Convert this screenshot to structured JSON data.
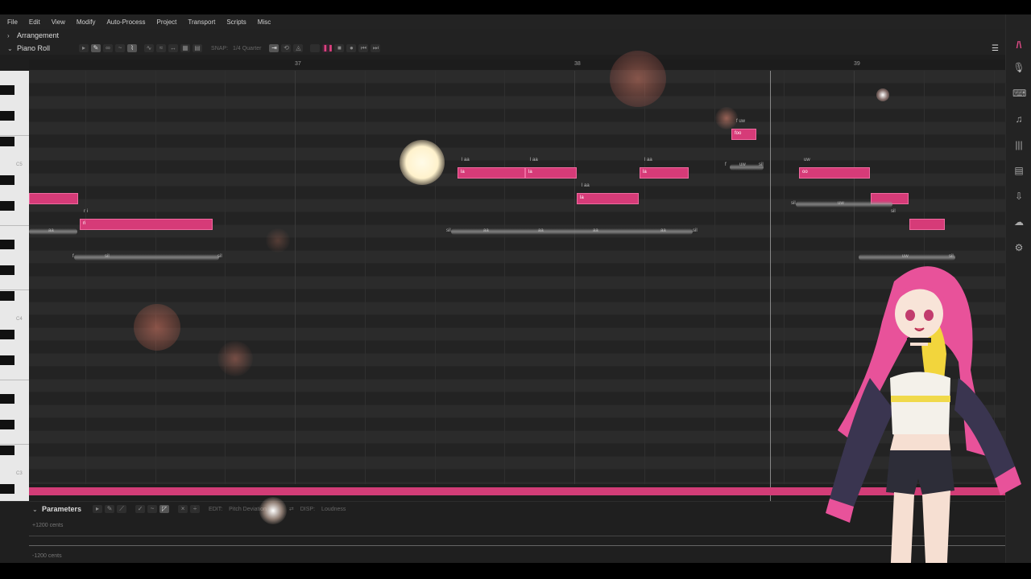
{
  "menu": [
    "File",
    "Edit",
    "View",
    "Modify",
    "Auto-Process",
    "Project",
    "Transport",
    "Scripts",
    "Misc"
  ],
  "arrangement": {
    "label": "Arrangement"
  },
  "piano_roll": {
    "label": "Piano Roll",
    "snap_label": "SNAP:",
    "snap_value": "1/4 Quarter"
  },
  "ruler": {
    "bars": [
      "37",
      "38",
      "39"
    ]
  },
  "keys": {
    "c_labels": [
      "C5",
      "C4",
      "C3"
    ]
  },
  "notes": [
    {
      "text": ""
    },
    {
      "text": "ri"
    },
    {
      "text": "la"
    },
    {
      "text": "la"
    },
    {
      "text": "la"
    },
    {
      "text": "la"
    },
    {
      "text": "foo"
    },
    {
      "text": "oo"
    },
    {
      "text": ""
    },
    {
      "text": ""
    }
  ],
  "lyrics": [
    "r i",
    "l aa",
    "l aa",
    "l aa",
    "l aa",
    "f uw",
    "uw",
    "f",
    "uw",
    "sil",
    "sil",
    "sil",
    "sil",
    "uw",
    "sil",
    "aa",
    "aa",
    "aa",
    "aa",
    "aa",
    "sil",
    "f",
    "sil",
    "uw",
    "sil"
  ],
  "params": {
    "label": "Parameters",
    "edit_label": "EDIT:",
    "edit_value": "Pitch Deviation",
    "disp_label": "DISP:",
    "disp_value": "Loudness",
    "cents_top": "+1200 cents",
    "cents_bottom": "-1200 cents"
  },
  "colors": {
    "note": "#d63b78",
    "note_border": "#f06aa0",
    "accent": "#d23d77",
    "background": "#1e1e1e"
  },
  "icons": [
    "microphone-icon",
    "keyboard-icon",
    "music-note-icon",
    "library-icon",
    "notebook-icon",
    "export-icon",
    "cloud-icon",
    "gear-icon"
  ]
}
